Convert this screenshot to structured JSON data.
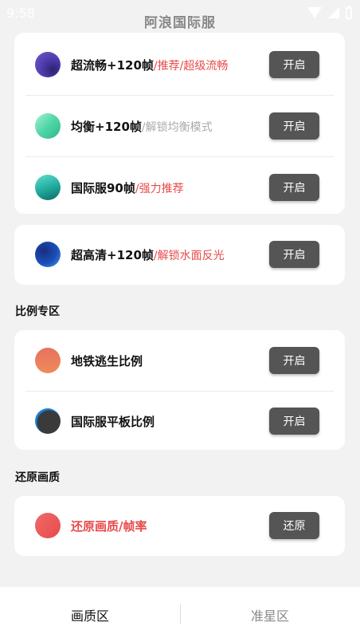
{
  "status_bar": {
    "time": "9:58"
  },
  "app": {
    "title": "阿浪国际服"
  },
  "card1": {
    "rows": [
      {
        "main": "超流畅+120帧",
        "sub": "/推荐/超级流畅",
        "sub_color": "#e84a4a",
        "button": "开启"
      },
      {
        "main": "均衡+120帧",
        "sub": "/解锁均衡模式",
        "sub_color": "#aaaaaa",
        "button": "开启"
      },
      {
        "main": "国际服90帧",
        "sub": "/强力推荐",
        "sub_color": "#e84a4a",
        "button": "开启"
      }
    ]
  },
  "card2": {
    "rows": [
      {
        "main": "超高清+120帧",
        "sub": "/解锁水面反光",
        "sub_color": "#e84a4a",
        "button": "开启"
      }
    ]
  },
  "ratio_section": {
    "title": "比例专区",
    "rows": [
      {
        "main": "地铁逃生比例",
        "button": "开启"
      },
      {
        "main": "国际服平板比例",
        "button": "开启"
      }
    ]
  },
  "restore_section": {
    "title": "还原画质",
    "rows": [
      {
        "main": "还原画质/帧率",
        "main_color": "#e84a4a",
        "button": "还原"
      }
    ]
  },
  "bottom_nav": {
    "tabs": [
      {
        "label": "画质区",
        "active": true
      },
      {
        "label": "准星区",
        "active": false
      }
    ]
  }
}
